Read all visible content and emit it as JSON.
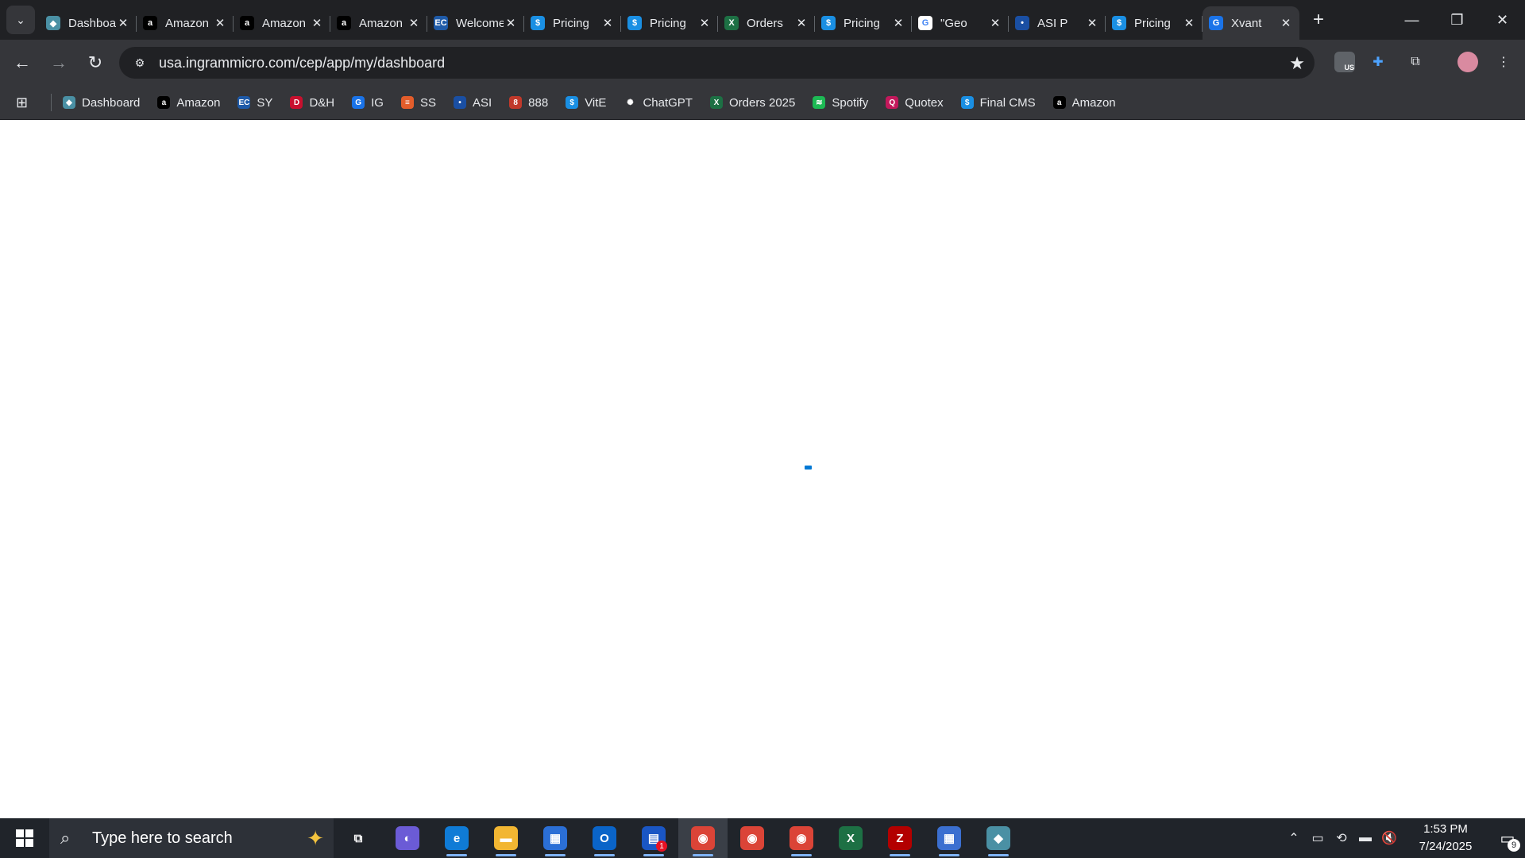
{
  "browser": {
    "tabs": [
      {
        "label": "Dashboard",
        "icon": "dashboard-hex-icon",
        "favicon_text": "◆",
        "color": "#4a90a4"
      },
      {
        "label": "Amazon",
        "icon": "amazon-icon",
        "favicon_text": "a",
        "color": "#000000"
      },
      {
        "label": "Amazon",
        "icon": "amazon-icon",
        "favicon_text": "a",
        "color": "#000000"
      },
      {
        "label": "Amazon",
        "icon": "amazon-icon",
        "favicon_text": "a",
        "color": "#000000"
      },
      {
        "label": "Welcome",
        "icon": "ec-icon",
        "favicon_text": "EC",
        "color": "#1e5aa8"
      },
      {
        "label": "Pricing",
        "icon": "dollar-icon",
        "favicon_text": "$",
        "color": "#1a8fe3"
      },
      {
        "label": "Pricing",
        "icon": "dollar-icon",
        "favicon_text": "$",
        "color": "#1a8fe3"
      },
      {
        "label": "Orders",
        "icon": "excel-icon",
        "favicon_text": "X",
        "color": "#1d7044"
      },
      {
        "label": "Pricing",
        "icon": "dollar-icon",
        "favicon_text": "$",
        "color": "#1a8fe3"
      },
      {
        "label": "\"Geo",
        "icon": "google-icon",
        "favicon_text": "G",
        "color": "#ffffff"
      },
      {
        "label": "ASI P",
        "icon": "asi-icon",
        "favicon_text": "•",
        "color": "#1a4fa3"
      },
      {
        "label": "Pricing",
        "icon": "dollar-icon",
        "favicon_text": "$",
        "color": "#1a8fe3"
      },
      {
        "label": "Xvant",
        "icon": "ingram-icon",
        "favicon_text": "G",
        "color": "#1a73e8",
        "active": true
      }
    ],
    "close_glyph": "✕",
    "new_tab_glyph": "+",
    "url": "usa.ingrammicro.com/cep/app/my/dashboard",
    "bookmarks": [
      {
        "label": "Dashboard",
        "icon": "dashboard-hex-icon",
        "favicon_text": "◆",
        "color": "#4a90a4"
      },
      {
        "label": "Amazon",
        "icon": "amazon-icon",
        "favicon_text": "a",
        "color": "#000000"
      },
      {
        "label": "SY",
        "icon": "ec-icon",
        "favicon_text": "EC",
        "color": "#1e5aa8"
      },
      {
        "label": "D&H",
        "icon": "dandh-icon",
        "favicon_text": "D",
        "color": "#c8102e"
      },
      {
        "label": "IG",
        "icon": "ingram-icon",
        "favicon_text": "G",
        "color": "#1a73e8"
      },
      {
        "label": "SS",
        "icon": "stack-icon",
        "favicon_text": "≡",
        "color": "#e35d2b"
      },
      {
        "label": "ASI",
        "icon": "asi-icon",
        "favicon_text": "•",
        "color": "#1a4fa3"
      },
      {
        "label": "888",
        "icon": "888-icon",
        "favicon_text": "8",
        "color": "#c0392b"
      },
      {
        "label": "VitE",
        "icon": "dollar-icon",
        "favicon_text": "$",
        "color": "#1a8fe3"
      },
      {
        "label": "ChatGPT",
        "icon": "chatgpt-icon",
        "favicon_text": "✺",
        "color": "#35363a"
      },
      {
        "label": "Orders 2025",
        "icon": "excel-icon",
        "favicon_text": "X",
        "color": "#1d7044"
      },
      {
        "label": "Spotify",
        "icon": "spotify-icon",
        "favicon_text": "≋",
        "color": "#1db954"
      },
      {
        "label": "Quotex",
        "icon": "quotex-icon",
        "favicon_text": "Q",
        "color": "#c2185b"
      },
      {
        "label": "Final CMS",
        "icon": "dollar-icon",
        "favicon_text": "$",
        "color": "#1a8fe3"
      },
      {
        "label": "Amazon",
        "icon": "amazon-icon",
        "favicon_text": "a",
        "color": "#000000"
      }
    ],
    "extension_badge": "US"
  },
  "taskbar": {
    "search_placeholder": "Type here to search",
    "apps": [
      {
        "name": "task-view",
        "glyph": "⧉",
        "color": "#20242a"
      },
      {
        "name": "copilot-app",
        "glyph": "◐",
        "color": "#6b5bd6"
      },
      {
        "name": "edge-app",
        "glyph": "e",
        "color": "#0f7bd6"
      },
      {
        "name": "file-explorer-app",
        "glyph": "▬",
        "color": "#f2b632"
      },
      {
        "name": "store-app",
        "glyph": "▦",
        "color": "#2b6fd6"
      },
      {
        "name": "outlook-app",
        "glyph": "O",
        "color": "#0a64c8"
      },
      {
        "name": "calendar-app",
        "glyph": "▤",
        "color": "#1a56c4",
        "badge": "1"
      },
      {
        "name": "chrome-app-1",
        "glyph": "◉",
        "color": "#db4437",
        "focused": true
      },
      {
        "name": "chrome-app-2",
        "glyph": "◉",
        "color": "#db4437"
      },
      {
        "name": "chrome-app-3",
        "glyph": "◉",
        "color": "#db4437"
      },
      {
        "name": "excel-app",
        "glyph": "X",
        "color": "#1d7044"
      },
      {
        "name": "filezilla-app",
        "glyph": "Z",
        "color": "#b30000"
      },
      {
        "name": "calculator-app",
        "glyph": "▦",
        "color": "#3b6fd0"
      },
      {
        "name": "hex-app",
        "glyph": "◆",
        "color": "#4a90a4"
      }
    ],
    "time": "1:53 PM",
    "date": "7/24/2025",
    "notification_count": "9"
  }
}
